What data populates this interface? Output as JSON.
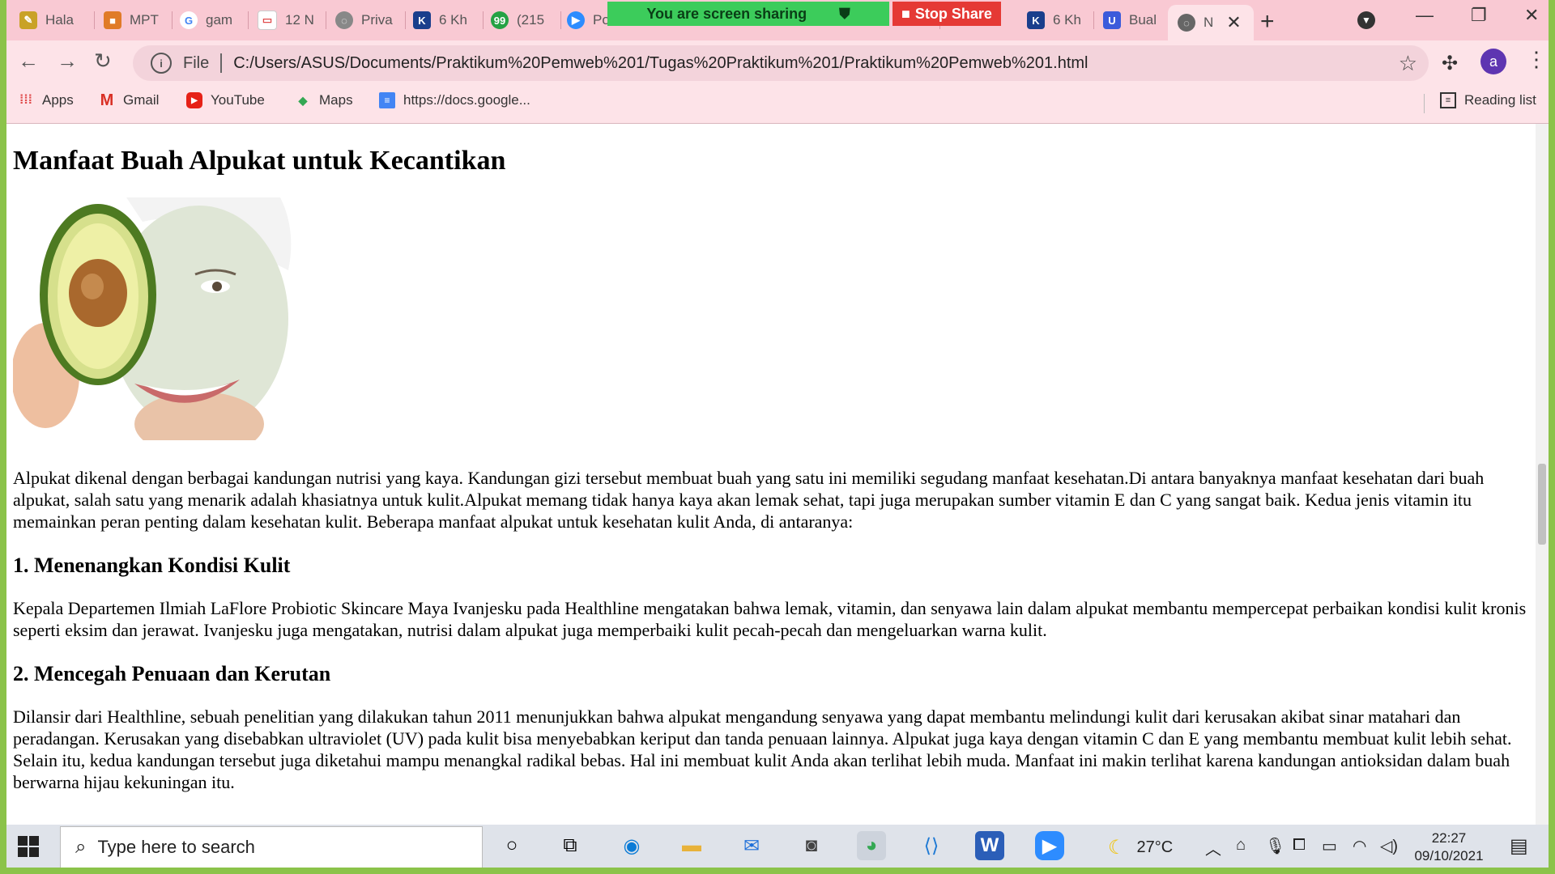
{
  "share": {
    "banner_label": "You are screen sharing",
    "stop_label": "Stop Share"
  },
  "tabs": [
    {
      "label": "Hala",
      "color": "#c9a227"
    },
    {
      "label": "MPT",
      "color": "#e07b28"
    },
    {
      "label": "gam",
      "color": "#4285f4"
    },
    {
      "label": "12 N",
      "color": "#e04b4b"
    },
    {
      "label": "Priva",
      "color": "#888888"
    },
    {
      "label": "6 Kh",
      "color": "#1a3e8c"
    },
    {
      "label": "(215",
      "color": "#25a244"
    },
    {
      "label": "Po",
      "color": "#2d8cff"
    },
    {
      "label": "6 Kh",
      "color": "#1a3e8c"
    },
    {
      "label": "Bual",
      "color": "#3b5bdb"
    },
    {
      "label": "N",
      "color": "#666666"
    }
  ],
  "toolbar": {
    "scheme": "File",
    "url": "C:/Users/ASUS/Documents/Praktikum%20Pemweb%201/Tugas%20Praktikum%201/Praktikum%20Pemweb%201.html",
    "avatar_letter": "a"
  },
  "bookmarks": {
    "items": [
      {
        "label": "Apps"
      },
      {
        "label": "Gmail"
      },
      {
        "label": "YouTube"
      },
      {
        "label": "Maps"
      },
      {
        "label": "https://docs.google..."
      }
    ],
    "reading_list": "Reading list"
  },
  "page": {
    "title": "Manfaat Buah Alpukat untuk Kecantikan",
    "intro": "Alpukat dikenal dengan berbagai kandungan nutrisi yang kaya. Kandungan gizi tersebut membuat buah yang satu ini memiliki segudang manfaat kesehatan.Di antara banyaknya manfaat kesehatan dari buah alpukat, salah satu yang menarik adalah khasiatnya untuk kulit.Alpukat memang tidak hanya kaya akan lemak sehat, tapi juga merupakan sumber vitamin E dan C yang sangat baik. Kedua jenis vitamin itu memainkan peran penting dalam kesehatan kulit. Beberapa manfaat alpukat untuk kesehatan kulit Anda, di antaranya:",
    "sections": [
      {
        "heading": "1. Menenangkan Kondisi Kulit",
        "body": "Kepala Departemen Ilmiah LaFlore Probiotic Skincare Maya Ivanjesku pada Healthline mengatakan bahwa lemak, vitamin, dan senyawa lain dalam alpukat membantu mempercepat perbaikan kondisi kulit kronis seperti eksim dan jerawat. Ivanjesku juga mengatakan, nutrisi dalam alpukat juga memperbaiki kulit pecah-pecah dan mengeluarkan warna kulit."
      },
      {
        "heading": "2. Mencegah Penuaan dan Kerutan",
        "body": "Dilansir dari Healthline, sebuah penelitian yang dilakukan tahun 2011 menunjukkan bahwa alpukat mengandung senyawa yang dapat membantu melindungi kulit dari kerusakan akibat sinar matahari dan peradangan. Kerusakan yang disebabkan ultraviolet (UV) pada kulit bisa menyebabkan keriput dan tanda penuaan lainnya. Alpukat juga kaya dengan vitamin C dan E yang membantu membuat kulit lebih sehat. Selain itu, kedua kandungan tersebut juga diketahui mampu menangkal radikal bebas. Hal ini membuat kulit Anda akan terlihat lebih muda. Manfaat ini makin terlihat karena kandungan antioksidan dalam buah berwarna hijau kekuningan itu."
      }
    ]
  },
  "taskbar": {
    "search_placeholder": "Type here to search",
    "temperature": "27°C",
    "time": "22:27",
    "date": "09/10/2021"
  },
  "colors": {
    "accent_border": "#8bc34a",
    "tabstrip": "#f9c9d3",
    "toolbar": "#fde3e8"
  }
}
